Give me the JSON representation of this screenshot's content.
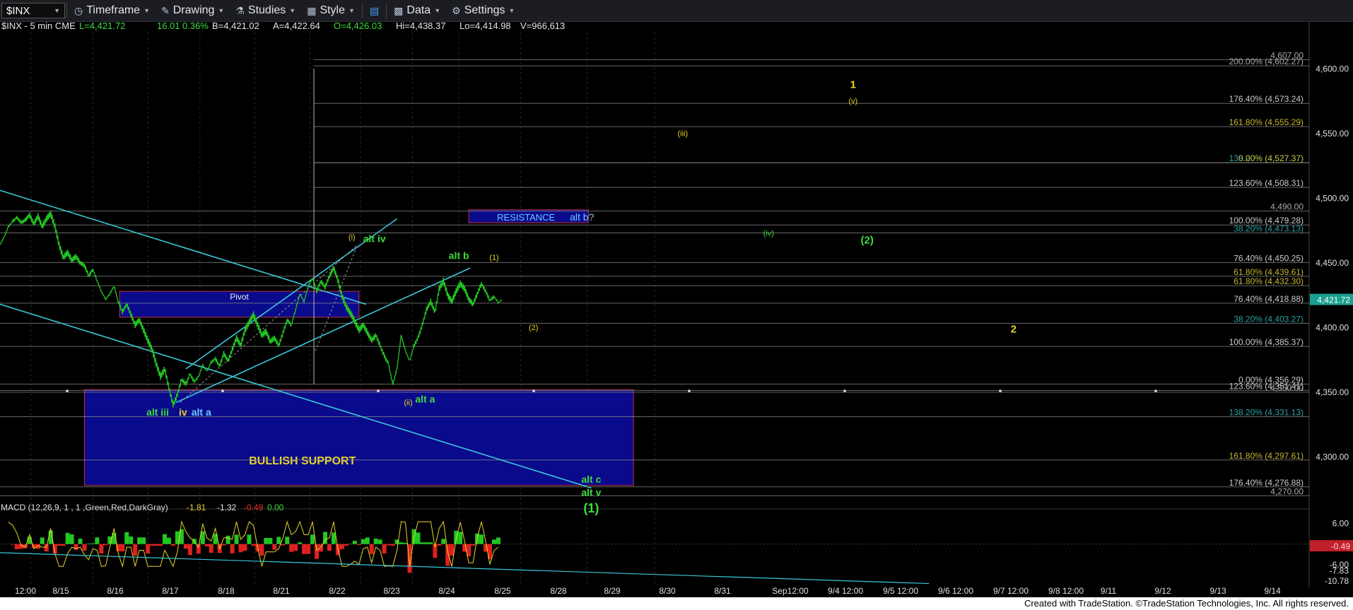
{
  "toolbar": {
    "symbol": "$INX",
    "items": [
      {
        "label": "Timeframe",
        "icon": "clock-icon"
      },
      {
        "label": "Drawing",
        "icon": "pencil-icon"
      },
      {
        "label": "Studies",
        "icon": "flask-icon"
      },
      {
        "label": "Style",
        "icon": "style-icon"
      },
      {
        "label": "",
        "icon": "layout-icon"
      },
      {
        "label": "Data",
        "icon": "bar-chart-icon"
      },
      {
        "label": "Settings",
        "icon": "gear-icon"
      }
    ]
  },
  "colors": {
    "background": "#000000",
    "price_line": "#22c622",
    "cyan_line": "#3ac8d8",
    "zone_fill": "#0a0a8c",
    "zone_border": "#c03040",
    "yellow": "#e8d42a",
    "green": "#3ddc3d",
    "last_price_tag": "#1aa090",
    "macd_tag": "#c0202a"
  },
  "header": {
    "symbol": "$INX - 5 min  CME",
    "last": "L=4,421.72",
    "chg": "16.01",
    "pct": "0.36%",
    "bid": "B=4,421.02",
    "ask": "A=4,422.64",
    "open": "O=4,426.03",
    "high": "Hi=4,438.37",
    "low": "Lo=4,414.98",
    "volume": "V=966,613"
  },
  "chart_data": {
    "type": "line",
    "price_axis": {
      "ticks": [
        4600,
        4550,
        4500,
        4450,
        4400,
        4350,
        4300
      ],
      "tick_labels": [
        "4,600.00",
        "4,550.00",
        "4,500.00",
        "4,450.00",
        "4,400.00",
        "4,350.00",
        "4,300.00"
      ],
      "ylim": [
        4262,
        4628
      ],
      "last_price": 4421.72,
      "last_price_label": "4,421.72"
    },
    "x_labels": [
      "12:00",
      "8/15",
      "8/16",
      "8/17",
      "8/18",
      "8/21",
      "8/22",
      "8/23",
      "8/24",
      "8/25",
      "8/28",
      "8/29",
      "8/30",
      "8/31",
      "Sep12:00",
      "9/4 12:00",
      "9/5 12:00",
      "9/6 12:00",
      "9/7 12:00",
      "9/8 12:00",
      "9/11",
      "9/12",
      "9/13",
      "9/14"
    ],
    "price_series": {
      "name": "",
      "x": [
        0,
        0.3,
        0.6,
        0.9,
        1.2,
        1.5,
        1.8,
        2.1,
        2.4,
        2.7,
        3.0,
        3.3,
        3.6,
        3.9,
        4.2,
        4.5,
        4.8,
        5.1,
        5.4,
        5.7,
        6.0,
        6.3,
        6.6,
        6.9,
        7.2,
        7.5,
        7.8,
        8.1,
        8.4,
        8.7,
        9.0,
        9.3,
        9.6,
        9.9,
        10.2,
        10.5,
        10.8,
        11.1,
        11.4,
        11.7,
        12.0,
        12.3,
        12.6,
        12.9,
        13.2,
        13.5,
        13.8,
        14.1,
        14.4,
        14.7,
        15.0,
        15.3,
        15.6,
        15.9,
        16.2,
        16.5,
        16.8,
        17.1,
        17.4,
        17.7,
        18.0,
        18.3,
        18.6,
        18.9,
        19.2,
        19.5,
        19.8,
        20.1,
        20.4,
        20.7,
        21.0,
        21.3,
        21.6,
        21.9,
        22.2,
        22.5,
        22.8,
        23.1,
        23.4,
        23.7,
        24.0,
        24.3,
        24.6,
        24.9,
        25.2,
        25.5,
        25.8,
        26.1,
        26.4,
        26.7,
        27.0,
        27.3,
        27.6,
        27.9,
        28.2,
        28.5,
        28.8,
        29.1,
        29.4,
        29.7,
        30.0,
        30.3,
        30.6,
        30.9,
        31.2,
        31.5,
        31.8,
        32.1,
        32.4,
        32.7,
        33.0,
        33.3,
        33.6,
        33.9,
        34.2,
        34.5,
        34.8,
        35.1,
        35.4,
        35.7,
        36.0,
        36.3,
        36.6,
        36.9,
        37.2,
        37.5,
        37.8,
        38.1,
        38.4,
        38.7,
        39.0,
        39.3,
        39.6,
        39.9,
        40.2,
        40.5,
        40.8,
        41.1,
        41.4,
        41.7,
        42.0,
        42.3,
        42.6
      ],
      "y": [
        4464,
        4470,
        4478,
        4482,
        4485,
        4481,
        4483,
        4487,
        4480,
        4486,
        4478,
        4484,
        4488,
        4478,
        4464,
        4454,
        4458,
        4452,
        4455,
        4450,
        4448,
        4440,
        4445,
        4436,
        4428,
        4422,
        4426,
        4432,
        4420,
        4412,
        4418,
        4410,
        4402,
        4406,
        4398,
        4390,
        4383,
        4372,
        4362,
        4368,
        4353,
        4340,
        4348,
        4360,
        4356,
        4364,
        4358,
        4362,
        4371,
        4366,
        4373,
        4376,
        4370,
        4380,
        4374,
        4383,
        4392,
        4386,
        4398,
        4404,
        4410,
        4402,
        4394,
        4397,
        4389,
        4392,
        4386,
        4396,
        4406,
        4402,
        4414,
        4426,
        4420,
        4432,
        4438,
        4428,
        4436,
        4431,
        4440,
        4446,
        4437,
        4424,
        4416,
        4411,
        4405,
        4398,
        4402,
        4396,
        4390,
        4394,
        4386,
        4378,
        4372,
        4356,
        4368,
        4394,
        4382,
        4374,
        4386,
        4392,
        4402,
        4414,
        4420,
        4412,
        4430,
        4436,
        4425,
        4420,
        4428,
        4434,
        4430,
        4422,
        4418,
        4426,
        4434,
        4428,
        4421,
        4424,
        4419,
        4421.7,
        4421.7,
        4421.7,
        4421.7,
        4421.7,
        4421.7,
        4421.7,
        4421.7,
        4421.7,
        4421.7,
        4421.7,
        4421.7,
        4421.7,
        4421.7,
        4421.7,
        4421.7,
        4421.7,
        4421.7,
        4421.7,
        4421.7,
        4421.7,
        4421.7,
        4421.7,
        4421.7
      ]
    },
    "levels": [
      {
        "label": "4,607.00",
        "price": 4607
      },
      {
        "label": "200.00% (4,602.27)",
        "price": 4602.27
      },
      {
        "label": "176.40% (4,573.24)",
        "price": 4573.24
      },
      {
        "label": "161.80% (4,555.29)",
        "price": 4555.29
      },
      {
        "label": "138.20% (4,527.37)",
        "price": 4527.37
      },
      {
        "label": "0.00% (4,527.37)",
        "price": 4527.37
      },
      {
        "label": "123.60% (4,508.31)",
        "price": 4508.31
      },
      {
        "label": "4,490.00",
        "price": 4490
      },
      {
        "label": "100.00% (4,479.28)",
        "price": 4479.28
      },
      {
        "label": "38.20% (4,473.13)",
        "price": 4473.13
      },
      {
        "label": "76.40% (4,450.25)",
        "price": 4450.25
      },
      {
        "label": "61.80% (4,439.61)",
        "price": 4439.61
      },
      {
        "label": "61.80% (4,432.30)",
        "price": 4432.3
      },
      {
        "label": "76.40% (4,418.88)",
        "price": 4418.88
      },
      {
        "label": "38.20% (4,403.27)",
        "price": 4403.27
      },
      {
        "label": "100.00% (4,385.37)",
        "price": 4385.37
      },
      {
        "label": "0.00% (4,356.29)",
        "price": 4356.29
      },
      {
        "label": "123.60% (4,351.41)",
        "price": 4351.41
      },
      {
        "label": "4,350.00",
        "price": 4350
      },
      {
        "label": "138.20% (4,331.13)",
        "price": 4331.13
      },
      {
        "label": "161.80% (4,297.61)",
        "price": 4297.61
      },
      {
        "label": "176.40% (4,276.88)",
        "price": 4276.88
      },
      {
        "label": "4,270.00",
        "price": 4270
      }
    ],
    "zones": [
      {
        "label": "BULLISH SUPPORT",
        "x": [
          6,
          45
        ],
        "y": [
          4278,
          4352
        ]
      },
      {
        "label": "Pivot",
        "x": [
          8.5,
          25.5
        ],
        "y": [
          4408,
          4428
        ]
      },
      {
        "label": "RESISTANCE",
        "label2": "alt b?",
        "x": [
          33.3,
          41.8
        ],
        "y": [
          4481,
          4491
        ]
      }
    ],
    "wave_labels": [
      {
        "text": "(i)",
        "x": 25,
        "y": 4468,
        "color": "yellow"
      },
      {
        "text": "alt iv",
        "x": 26.6,
        "y": 4466,
        "color": "green"
      },
      {
        "text": "alt b",
        "x": 32.6,
        "y": 4453,
        "color": "green"
      },
      {
        "text": "(1)",
        "x": 35.1,
        "y": 4452,
        "color": "yellow"
      },
      {
        "text": "(2)",
        "x": 37.9,
        "y": 4398,
        "color": "yellow"
      },
      {
        "text": "(ii)",
        "x": 29.0,
        "y": 4340,
        "color": "yellow"
      },
      {
        "text": "alt a",
        "x": 30.2,
        "y": 4342,
        "color": "green"
      },
      {
        "text": "alt iii",
        "x": 11.2,
        "y": 4332,
        "color": "green"
      },
      {
        "text": "iv",
        "x": 13,
        "y": 4332,
        "color": "yellow"
      },
      {
        "text": "alt a",
        "x": 14.3,
        "y": 4332,
        "color": "cyan"
      },
      {
        "text": "(iii)",
        "x": 48.5,
        "y": 4548,
        "color": "yellow"
      },
      {
        "text": "(iv)",
        "x": 54.6,
        "y": 4471,
        "color": "green"
      },
      {
        "text": "(2)",
        "x": 61.6,
        "y": 4465,
        "color": "green"
      },
      {
        "text": "1",
        "x": 60.6,
        "y": 4585,
        "color": "yellow"
      },
      {
        "text": "(v)",
        "x": 60.6,
        "y": 4573,
        "color": "yellow"
      },
      {
        "text": "2",
        "x": 72,
        "y": 4396,
        "color": "yellow"
      },
      {
        "text": "alt c",
        "x": 42,
        "y": 4280,
        "color": "green"
      },
      {
        "text": "alt v",
        "x": 42,
        "y": 4270,
        "color": "green"
      },
      {
        "text": "(1)",
        "x": 42,
        "y": 4257,
        "color": "green"
      }
    ],
    "trend_lines": [
      {
        "x1": 0,
        "y1": 4506,
        "x2": 26,
        "y2": 4418
      },
      {
        "x1": 0,
        "y1": 4418,
        "x2": 42,
        "y2": 4276
      },
      {
        "x1": 12.5,
        "y1": 4342,
        "x2": 33.4,
        "y2": 4446
      },
      {
        "x1": 13.2,
        "y1": 4368,
        "x2": 28.2,
        "y2": 4484
      }
    ],
    "macd": {
      "title": "MACD (12,26,9, 1 , 1 ,Green,Red,DarkGray)",
      "values": [
        "-1.81",
        "-1.32",
        "-0.49",
        "0.00"
      ],
      "ticks": [
        6,
        -6
      ],
      "tick_labels": [
        "6.00",
        "-6.00"
      ],
      "ylim": [
        -12,
        9
      ],
      "last_label": "-0.49",
      "extra_labels": [
        "-7.83",
        "-10.78"
      ]
    }
  },
  "footer": "Created with TradeStation. ©TradeStation Technologies, Inc. All rights reserved."
}
